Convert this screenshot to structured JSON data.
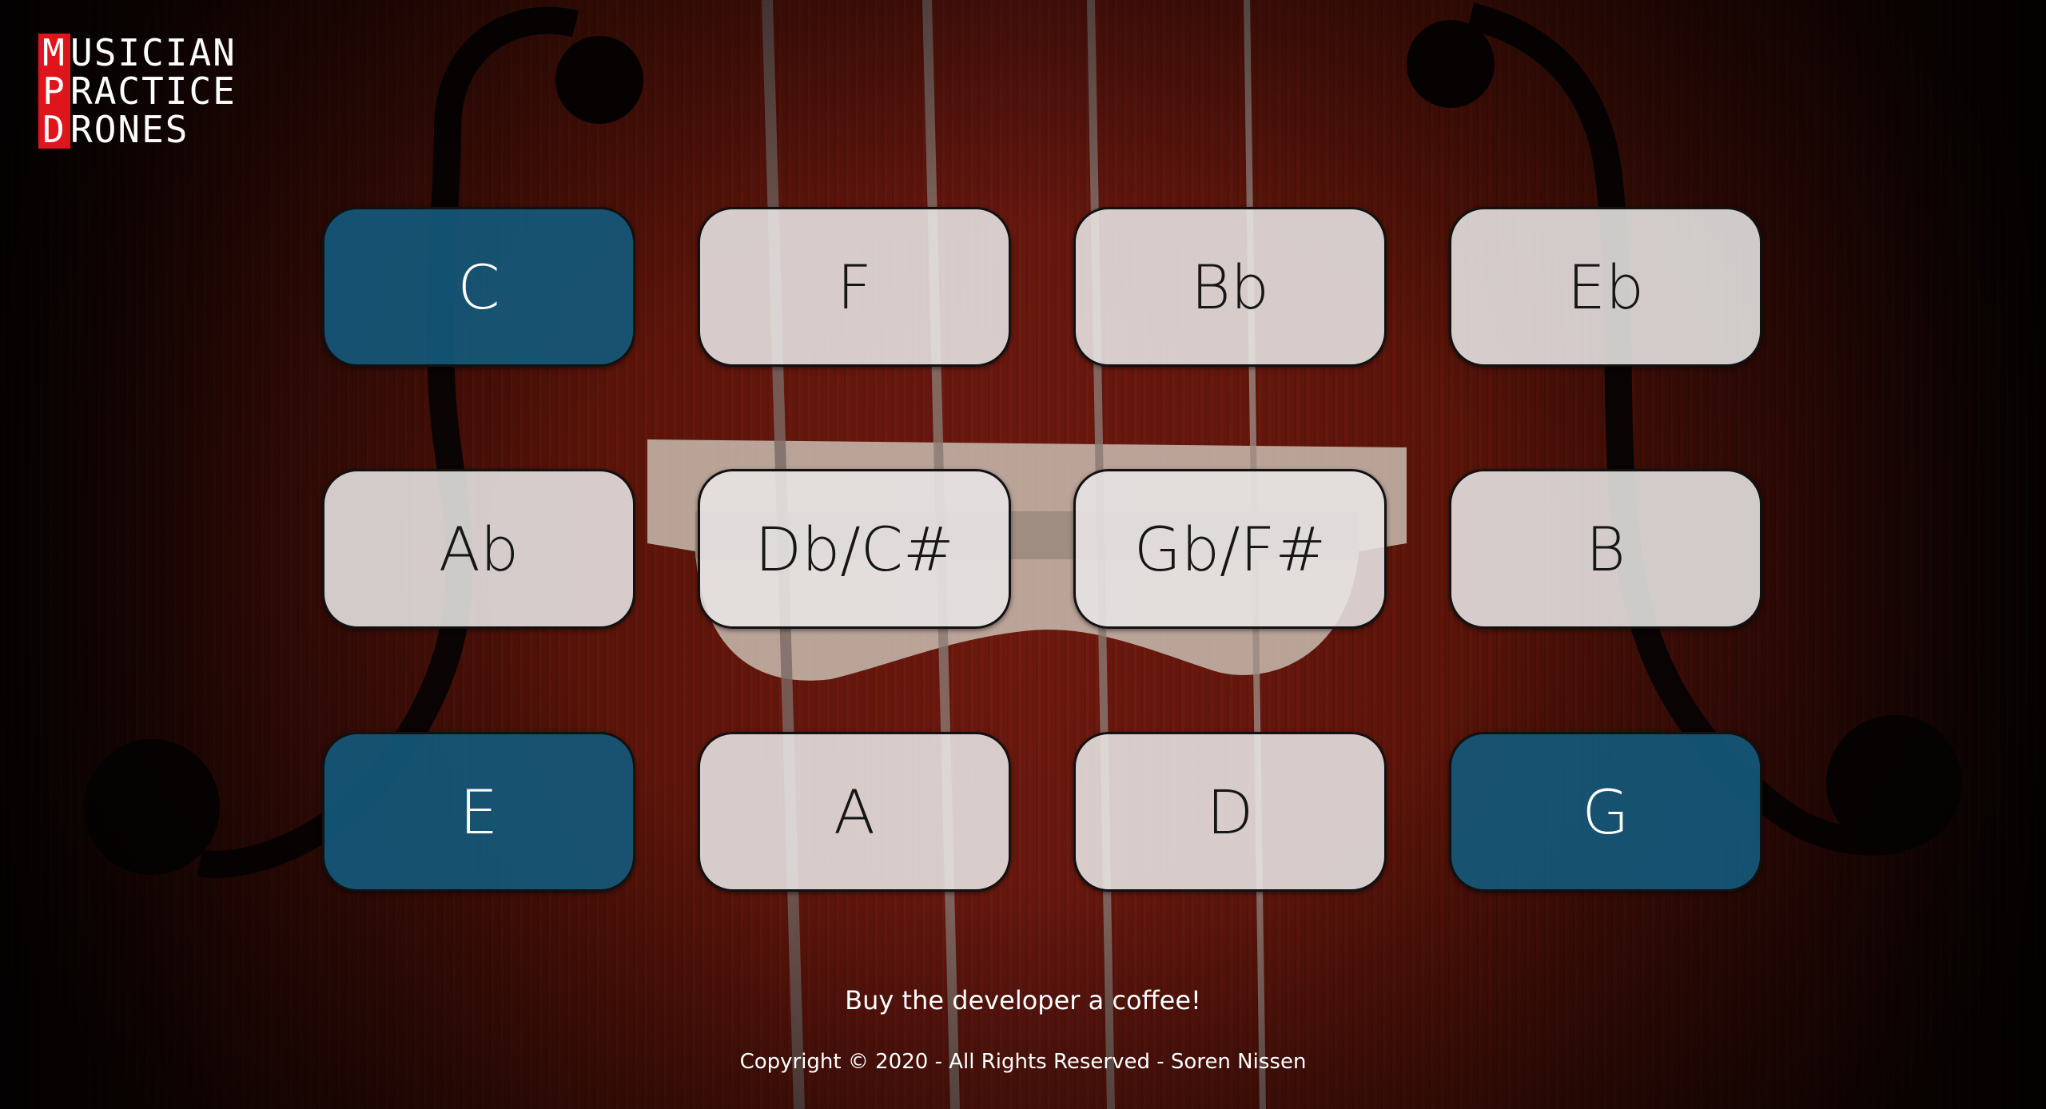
{
  "logo": {
    "lines": [
      {
        "initial": "M",
        "rest": "USICIAN"
      },
      {
        "initial": "P",
        "rest": "RACTICE"
      },
      {
        "initial": "D",
        "rest": "RONES"
      }
    ]
  },
  "keys": [
    {
      "label": "C",
      "active": true
    },
    {
      "label": "F",
      "active": false
    },
    {
      "label": "Bb",
      "active": false
    },
    {
      "label": "Eb",
      "active": false
    },
    {
      "label": "Ab",
      "active": false
    },
    {
      "label": "Db/C#",
      "active": false
    },
    {
      "label": "Gb/F#",
      "active": false
    },
    {
      "label": "B",
      "active": false
    },
    {
      "label": "E",
      "active": true
    },
    {
      "label": "A",
      "active": false
    },
    {
      "label": "D",
      "active": false
    },
    {
      "label": "G",
      "active": true
    }
  ],
  "footer": {
    "coffee_link": "Buy the developer a coffee!",
    "copyright": "Copyright © 2020 - All Rights Reserved - Soren Nissen"
  },
  "colors": {
    "active_key": "#14587a",
    "inactive_key": "#e8e6e6",
    "logo_red": "#e0141b"
  }
}
